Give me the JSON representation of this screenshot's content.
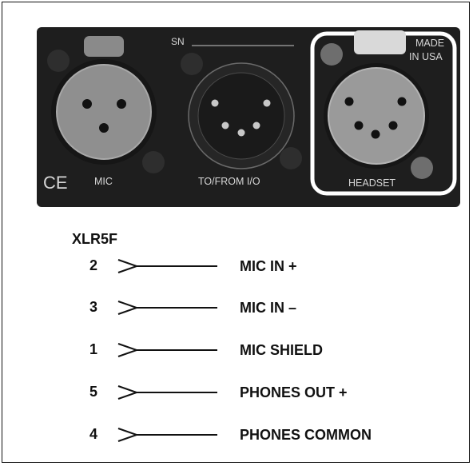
{
  "panel": {
    "serial_label": "SN",
    "made_in": [
      "MADE",
      "IN USA"
    ],
    "ce_mark": "CE",
    "connectors": [
      {
        "id": "mic",
        "label": "MIC"
      },
      {
        "id": "io",
        "label": "TO/FROM I/O"
      },
      {
        "id": "headset",
        "label": "HEADSET"
      }
    ],
    "colors": {
      "panel": "#1e1e1e",
      "connector": "#8f8f8f",
      "highlight": "#ffffff"
    }
  },
  "pinout": {
    "connector_type": "XLR5F",
    "pins": [
      {
        "pin": "2",
        "signal": "MIC IN +"
      },
      {
        "pin": "3",
        "signal": "MIC IN –"
      },
      {
        "pin": "1",
        "signal": "MIC SHIELD"
      },
      {
        "pin": "5",
        "signal": "PHONES OUT +"
      },
      {
        "pin": "4",
        "signal": "PHONES COMMON"
      }
    ]
  }
}
